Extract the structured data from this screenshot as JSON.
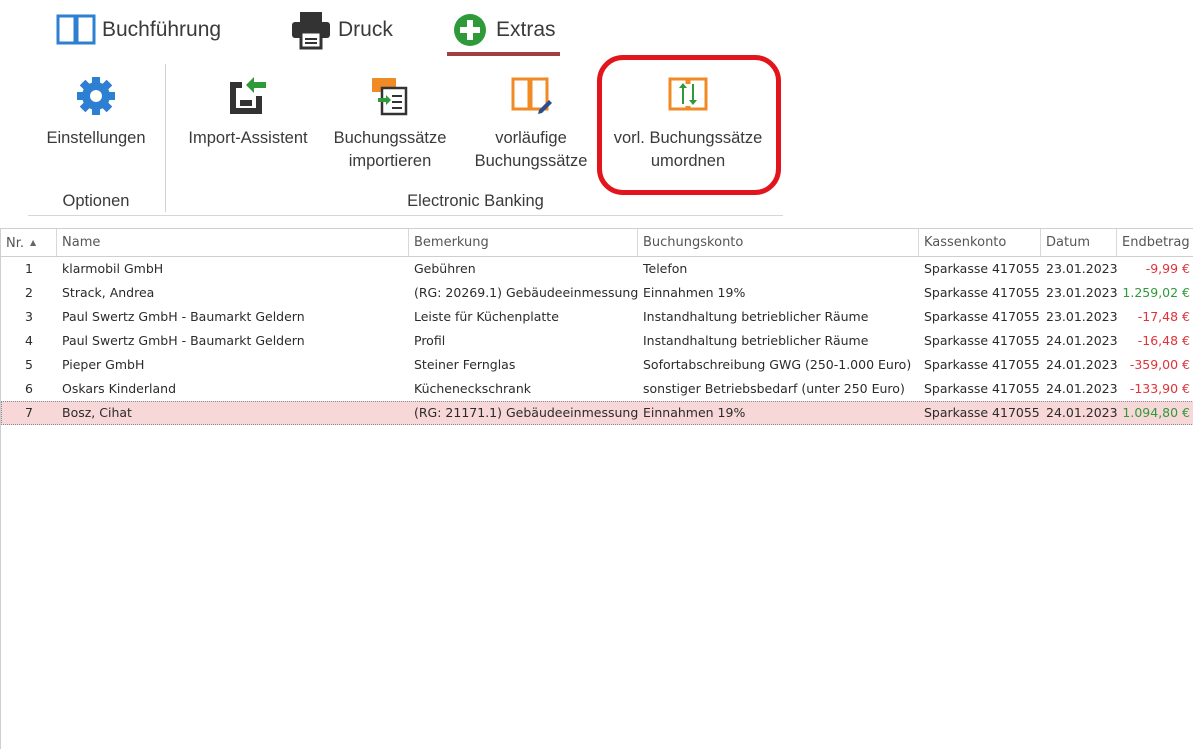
{
  "tabs": [
    {
      "label": "Buchführung",
      "icon": "book-icon"
    },
    {
      "label": "Druck",
      "icon": "printer-icon"
    },
    {
      "label": "Extras",
      "icon": "plus-circle-icon",
      "active": true
    }
  ],
  "ribbon": {
    "buttons": [
      {
        "label_line1": "Einstellungen",
        "label_line2": "",
        "icon": "gear-icon"
      },
      {
        "label_line1": "Import-Assistent",
        "label_line2": "",
        "icon": "import-icon"
      },
      {
        "label_line1": "Buchungssätze",
        "label_line2": "importieren",
        "icon": "import-entries-icon"
      },
      {
        "label_line1": "vorläufige",
        "label_line2": "Buchungssätze",
        "icon": "book-edit-icon"
      },
      {
        "label_line1": "vorl. Buchungssätze",
        "label_line2": "umordnen",
        "icon": "book-reorder-icon"
      }
    ],
    "groups": [
      {
        "label": "Optionen"
      },
      {
        "label": "Electronic Banking"
      }
    ]
  },
  "grid": {
    "columns": [
      "Nr.",
      "Name",
      "Bemerkung",
      "Buchungskonto",
      "Kassenkonto",
      "Datum",
      "Endbetrag"
    ],
    "rows": [
      {
        "nr": "1",
        "name": "klarmobil GmbH",
        "bemerkung": "Gebühren",
        "buchungskonto": "Telefon",
        "kassenkonto": "Sparkasse 417055",
        "datum": "23.01.2023",
        "endbetrag": "-9,99 €",
        "sign": "neg"
      },
      {
        "nr": "2",
        "name": "Strack, Andrea",
        "bemerkung": "(RG: 20269.1) Gebäudeeinmessung",
        "buchungskonto": "Einnahmen 19%",
        "kassenkonto": "Sparkasse 417055",
        "datum": "23.01.2023",
        "endbetrag": "1.259,02 €",
        "sign": "pos"
      },
      {
        "nr": "3",
        "name": "Paul Swertz GmbH - Baumarkt Geldern",
        "bemerkung": "Leiste für  Küchenplatte",
        "buchungskonto": "Instandhaltung betrieblicher Räume",
        "kassenkonto": "Sparkasse 417055",
        "datum": "23.01.2023",
        "endbetrag": "-17,48 €",
        "sign": "neg"
      },
      {
        "nr": "4",
        "name": "Paul Swertz GmbH - Baumarkt Geldern",
        "bemerkung": "Profil",
        "buchungskonto": "Instandhaltung betrieblicher Räume",
        "kassenkonto": "Sparkasse 417055",
        "datum": "24.01.2023",
        "endbetrag": "-16,48 €",
        "sign": "neg"
      },
      {
        "nr": "5",
        "name": "Pieper GmbH",
        "bemerkung": "Steiner Fernglas",
        "buchungskonto": "Sofortabschreibung GWG (250-1.000 Euro)",
        "kassenkonto": "Sparkasse 417055",
        "datum": "24.01.2023",
        "endbetrag": "-359,00 €",
        "sign": "neg"
      },
      {
        "nr": "6",
        "name": "Oskars Kinderland",
        "bemerkung": "Kücheneckschrank",
        "buchungskonto": "sonstiger Betriebsbedarf (unter 250 Euro)",
        "kassenkonto": "Sparkasse 417055",
        "datum": "24.01.2023",
        "endbetrag": "-133,90 €",
        "sign": "neg"
      },
      {
        "nr": "7",
        "name": "Bosz, Cihat",
        "bemerkung": "(RG: 21171.1) Gebäudeeinmessung",
        "buchungskonto": "Einnahmen 19%",
        "kassenkonto": "Sparkasse 417055",
        "datum": "24.01.2023",
        "endbetrag": "1.094,80 €",
        "sign": "pos",
        "selected": true
      }
    ]
  },
  "colors": {
    "accent_blue": "#2c7fd1",
    "accent_orange": "#f08a24",
    "accent_green": "#2e9a3a",
    "highlight_red": "#e3151c",
    "selected_row": "#f7d7d7",
    "negative": "#e0323a",
    "positive": "#2e9a3a"
  }
}
